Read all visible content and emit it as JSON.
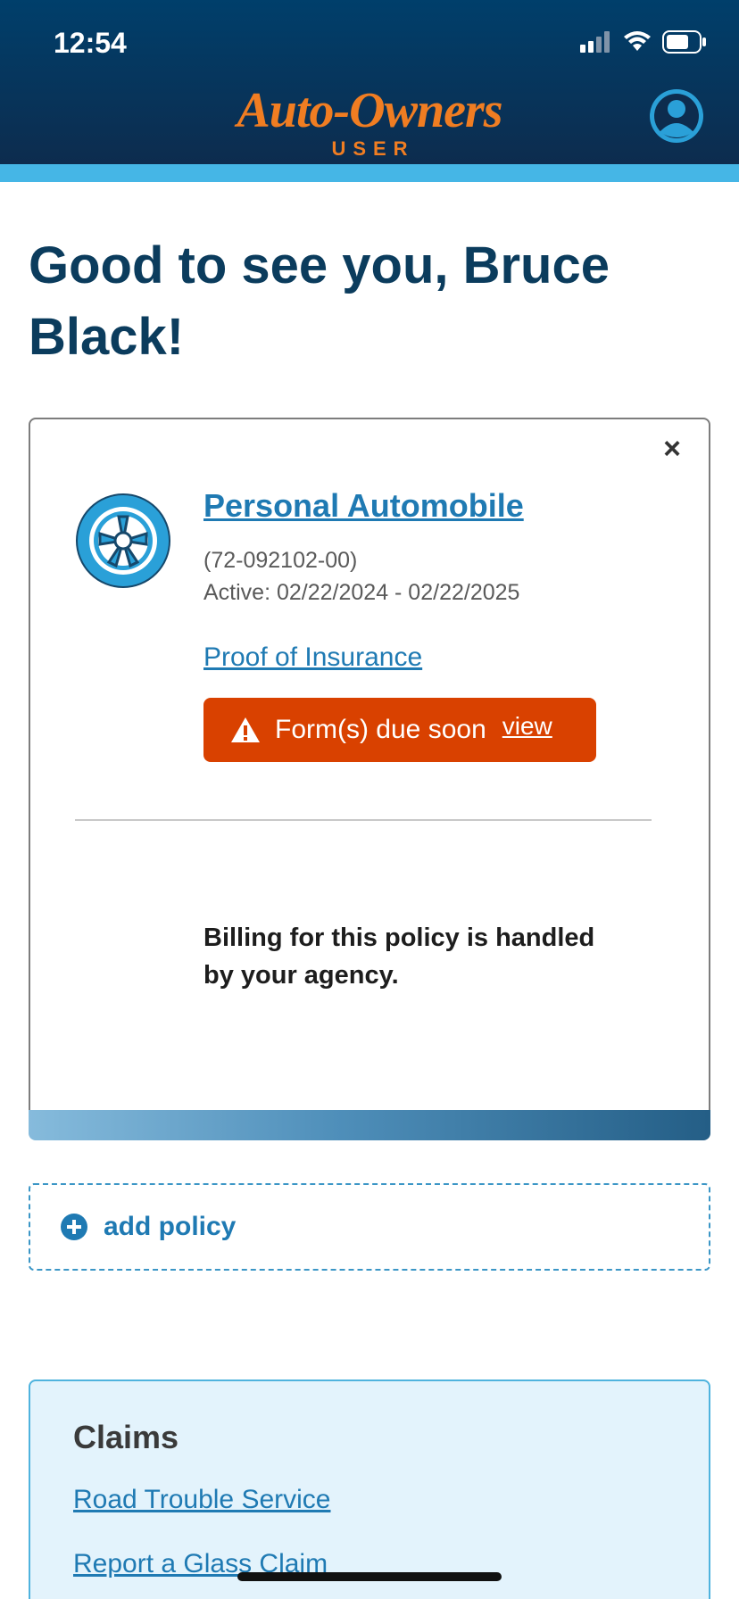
{
  "status_bar": {
    "time": "12:54"
  },
  "header": {
    "brand_name": "Auto-Owners",
    "brand_sub": "USER",
    "brand_color": "#f07d22",
    "header_color": "#003f6b",
    "stripe_color": "#45b6e6"
  },
  "greeting": "Good to see you, Bruce Black!",
  "policy_card": {
    "title": "Personal Automobile",
    "policy_number": "(72-092102-00)",
    "active": "Active: 02/22/2024 - 02/22/2025",
    "proof_link": "Proof of Insurance",
    "alert": {
      "text": "Form(s) due soon",
      "link": "view",
      "color": "#d94100"
    },
    "billing_note": "Billing for this policy is handled by your agency.",
    "close_label": "×",
    "icon": "wheel-icon"
  },
  "add_policy": {
    "label": "add policy",
    "icon": "plus-circle-icon"
  },
  "claims": {
    "title": "Claims",
    "links": [
      "Road Trouble Service",
      "Report a Glass Claim"
    ]
  },
  "colors": {
    "link": "#1f7ab3",
    "heading": "#0b3c5d"
  }
}
